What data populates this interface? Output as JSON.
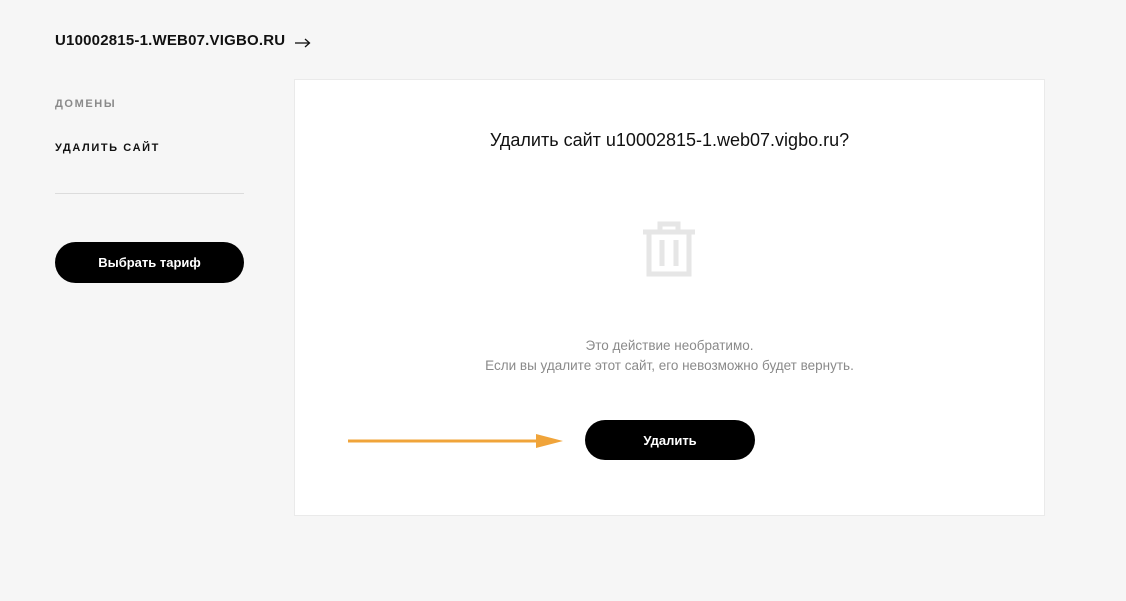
{
  "header": {
    "site_name": "U10002815-1.WEB07.VIGBO.RU",
    "arrow_icon": "arrow-right-icon"
  },
  "sidebar": {
    "items": [
      {
        "label": "ДОМЕНЫ",
        "active": false
      },
      {
        "label": "УДАЛИТЬ САЙТ",
        "active": true
      }
    ],
    "tariff_button_label": "Выбрать тариф"
  },
  "dialog": {
    "title": "Удалить сайт u10002815-1.web07.vigbo.ru?",
    "icon": "trash-icon",
    "warning_line1": "Это действие необратимо.",
    "warning_line2": "Если вы удалите этот сайт, его невозможно будет вернуть.",
    "delete_button_label": "Удалить"
  },
  "annotation": {
    "arrow_color": "#f0a43a"
  },
  "colors": {
    "background": "#f6f6f6",
    "panel": "#ffffff",
    "button": "#000000",
    "muted_text": "#8a8a8a"
  }
}
